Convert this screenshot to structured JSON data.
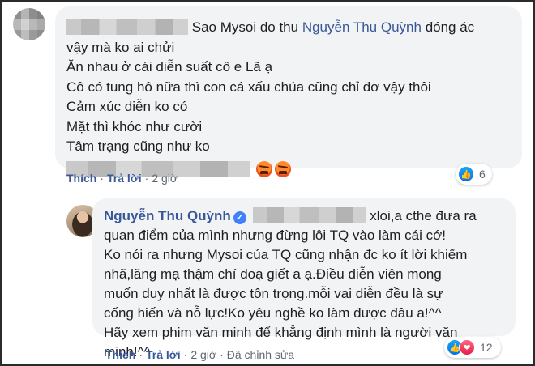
{
  "comment1": {
    "lead_text": "Sao Mysoi do thu",
    "mention": "Nguyễn Thu Quỳnh",
    "mention_suffix": "đóng ác",
    "lines": [
      "vậy mà ko ai chửi",
      "Ăn nhau ở cái diễn suất cô e Lã ạ",
      "Cô có tung hô nữa thì con cá xấu chúa cũng chỉ đơ vậy thôi",
      "Cảm xúc diễn ko có",
      "Mặt thì khóc như cười",
      "Tâm trạng cũng như ko"
    ],
    "actions": {
      "like": "Thích",
      "reply": "Trả lời",
      "time": "2 giờ"
    },
    "reaction_count": "6",
    "reaction_icons": [
      "like-icon"
    ],
    "emoji_icons": [
      "angry-emoji-icon",
      "angry-emoji-icon"
    ]
  },
  "reply": {
    "author": "Nguyễn Thu Quỳnh",
    "verified_icon": "verified-badge-icon",
    "first_line_text": "xloi,a cthe đưa ra",
    "lines": [
      "quan điểm của mình nhưng đừng lôi TQ vào làm cái cớ!",
      "Ko nói ra nhưng Mysoi của TQ cũng nhận đc ko ít lời khiếm",
      "nhã,lăng mạ thậm chí doạ giết a ạ.Điều diễn viên mong",
      "muốn duy nhất là được tôn trọng.mỗi vai diễn đều là sự",
      "cống hiến và nỗ lực!Ko yêu nghề ko làm được đâu a!^^",
      "Hãy xem phim văn minh để khẳng định mình là người văn",
      "minh!^^"
    ],
    "actions": {
      "like": "Thích",
      "reply": "Trả lời",
      "time": "2 giờ",
      "edited": "Đã chỉnh sửa"
    },
    "reaction_count": "12",
    "reaction_icons": [
      "like-icon",
      "love-icon"
    ]
  },
  "colors": {
    "bubble": "#f2f3f5",
    "link": "#385898",
    "meta": "#606770",
    "text": "#1c1e21"
  }
}
